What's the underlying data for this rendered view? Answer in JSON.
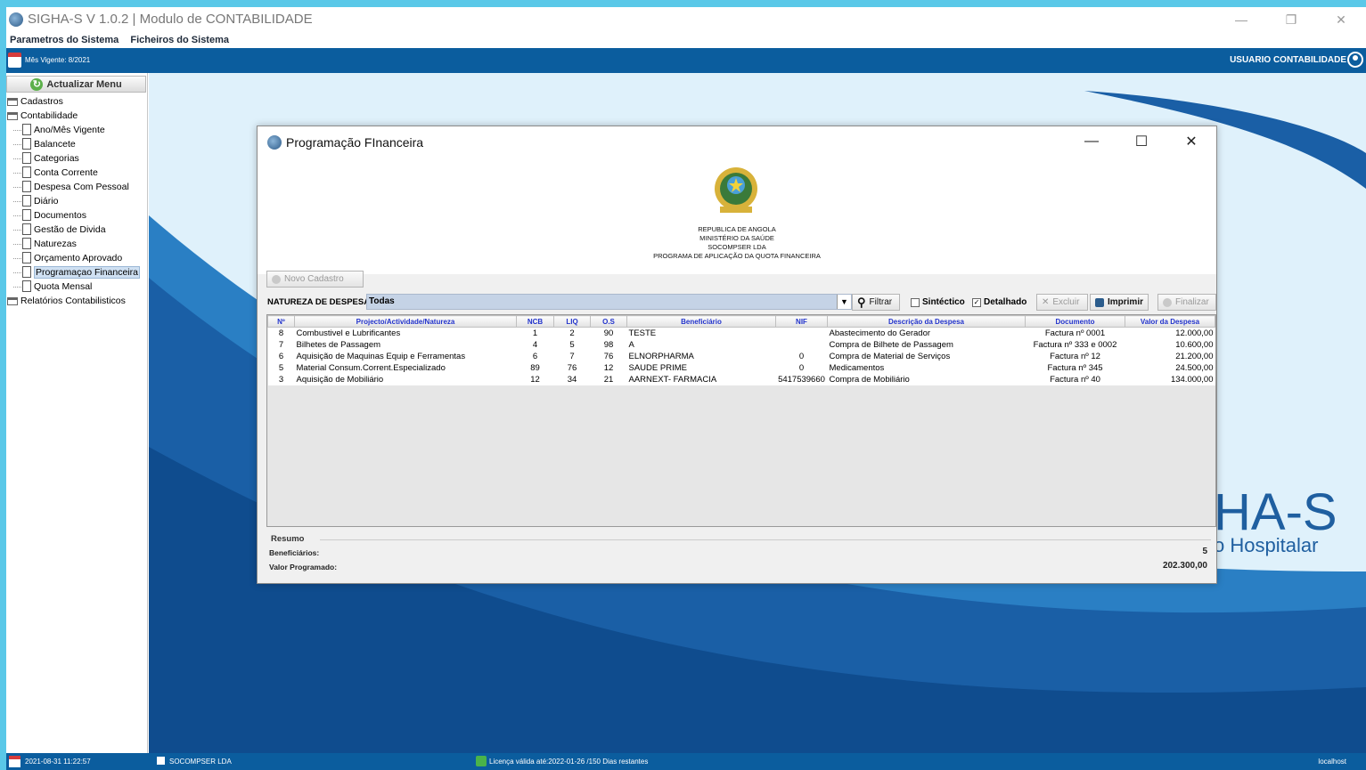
{
  "window": {
    "title": "SIGHA-S V 1.0.2 | Modulo de CONTABILIDADE"
  },
  "menubar": {
    "items": [
      "Parametros do Sistema",
      "Ficheiros do Sistema"
    ]
  },
  "infobar": {
    "mes_vigente": "Mês Vigente: 8/2021",
    "user": "USUARIO CONTABILIDADE"
  },
  "sidebar": {
    "refresh_label": "Actualizar Menu",
    "cadastros": "Cadastros",
    "contabilidade": "Contabilidade",
    "items": [
      "Ano/Mês Vigente",
      "Balancete",
      "Categorias",
      "Conta Corrente",
      "Despesa Com Pessoal",
      "Diário",
      "Documentos",
      "Gestão de Divida",
      "Naturezas",
      "Orçamento Aprovado",
      "Programaçao Financeira",
      "Quota Mensal"
    ],
    "relatorios": "Relatórios Contabilisticos"
  },
  "desktop": {
    "brand_main": "HA-S",
    "brand_sub": "o Hospitalar"
  },
  "statusbar": {
    "datetime": "2021-08-31 11:22:57",
    "company": "SOCOMPSER LDA",
    "license": "Licença válida até:2022-01-26 /150 Dias restantes",
    "host": "localhost"
  },
  "dialog": {
    "title": "Programação FInanceira",
    "header_lines": [
      "REPUBLICA DE ANGOLA",
      "MINISTÉRIO DA SAÚDE",
      "SOCOMPSER LDA",
      "PROGRAMA DE APLICAÇÃO DA QUOTA FINANCEIRA"
    ],
    "novo_cadastro": "Novo Cadastro",
    "natureza_label": "NATUREZA DE DESPESA:",
    "natureza_value": "Todas",
    "filtrar": "Filtrar",
    "sintetico": "Sintéctico",
    "detalhado": "Detalhado",
    "excluir": "Excluir",
    "imprimir": "Imprimir",
    "finalizar": "Finalizar",
    "columns": [
      "Nº",
      "Projecto/Actividade/Natureza",
      "NCB",
      "LIQ",
      "O.S",
      "Beneficiário",
      "NIF",
      "Descrição da Despesa",
      "Documento",
      "Valor da Despesa"
    ],
    "rows": [
      [
        "8",
        "Combustivel e Lubrificantes",
        "1",
        "2",
        "90",
        "TESTE",
        "",
        "Abastecimento do Gerador",
        "Factura nº 0001",
        "12.000,00"
      ],
      [
        "7",
        "Bilhetes de Passagem",
        "4",
        "5",
        "98",
        "A",
        "",
        "Compra de Bilhete de Passagem",
        "Factura nº 333 e 0002",
        "10.600,00"
      ],
      [
        "6",
        "Aquisição de Maquinas Equip e Ferramentas",
        "6",
        "7",
        "76",
        "ELNORPHARMA",
        "0",
        "Compra de Material de Serviços",
        "Factura nº 12",
        "21.200,00"
      ],
      [
        "5",
        "Material Consum.Corrent.Especializado",
        "89",
        "76",
        "12",
        "SAUDE PRIME",
        "0",
        "Medicamentos",
        "Factura nº 345",
        "24.500,00"
      ],
      [
        "3",
        "Aquisição de Mobiliário",
        "12",
        "34",
        "21",
        "AARNEXT- FARMACIA",
        "5417539660",
        "Compra de Mobiliário",
        "Factura nº 40",
        "134.000,00"
      ]
    ],
    "resumo": {
      "title": "Resumo",
      "beneficiarios_label": "Beneficiários:",
      "beneficiarios_value": "5",
      "valor_label": "Valor Programado:",
      "valor_value": "202.300,00"
    }
  }
}
